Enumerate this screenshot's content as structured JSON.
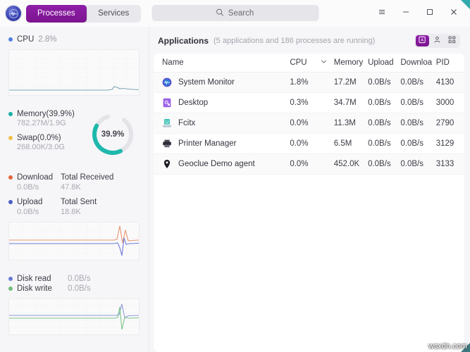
{
  "titlebar": {
    "logo_icon": "system-monitor-logo-icon",
    "tabs": [
      {
        "label": "Processes",
        "active": true
      },
      {
        "label": "Services",
        "active": false
      }
    ],
    "search": {
      "placeholder": "Search",
      "value": "",
      "icon": "search-icon"
    },
    "controls": [
      {
        "name": "menu-button",
        "icon": "hamburger-icon"
      },
      {
        "name": "minimize-button",
        "icon": "minimize-icon"
      },
      {
        "name": "maximize-button",
        "icon": "maximize-icon"
      },
      {
        "name": "close-button",
        "icon": "close-icon"
      }
    ]
  },
  "sidebar": {
    "cpu": {
      "label": "CPU",
      "value": "2.8%",
      "color": "#4f7fe0"
    },
    "memory": {
      "label": "Memory(39.9%)",
      "detail": "782.27M/1.9G",
      "color": "#18b0a6",
      "swap_label": "Swap(0.0%)",
      "swap_detail": "268.00K/3.0G",
      "swap_color": "#f0c04a",
      "donut_percent": "39.9%",
      "donut_value": 39.9
    },
    "network": {
      "download_label": "Download",
      "download_value": "0.0B/s",
      "download_color": "#e2663b",
      "upload_label": "Upload",
      "upload_value": "0.0B/s",
      "upload_color": "#4a5fc1",
      "total_received_label": "Total Received",
      "total_received_value": "47.8K",
      "total_sent_label": "Total Sent",
      "total_sent_value": "18.8K"
    },
    "disk": {
      "read_label": "Disk read",
      "read_value": "0.0B/s",
      "read_color": "#6b79d6",
      "write_label": "Disk write",
      "write_value": "0.0B/s",
      "write_color": "#6fbd7a"
    }
  },
  "main": {
    "section_title": "Applications",
    "section_subtitle": "(5 applications and 186 processes are running)",
    "view_modes": [
      {
        "name": "applications-view",
        "icon": "applications-icon",
        "active": true
      },
      {
        "name": "my-processes-view",
        "icon": "user-icon",
        "active": false
      },
      {
        "name": "all-processes-view",
        "icon": "grid-icon",
        "active": false
      }
    ],
    "columns": [
      {
        "key": "name",
        "label": "Name"
      },
      {
        "key": "cpu",
        "label": "CPU",
        "sorted": true,
        "sort_icon": "chevron-down-icon"
      },
      {
        "key": "memory",
        "label": "Memory"
      },
      {
        "key": "upload",
        "label": "Upload"
      },
      {
        "key": "download",
        "label": "Downloa"
      },
      {
        "key": "pid",
        "label": "PID"
      }
    ],
    "rows": [
      {
        "icon": "system-monitor-app-icon",
        "name": "System Monitor",
        "cpu": "1.8%",
        "memory": "17.2M",
        "upload": "0.0B/s",
        "download": "0.0B/s",
        "pid": "4130"
      },
      {
        "icon": "desktop-app-icon",
        "name": "Desktop",
        "cpu": "0.3%",
        "memory": "34.7M",
        "upload": "0.0B/s",
        "download": "0.0B/s",
        "pid": "3000"
      },
      {
        "icon": "fcitx-app-icon",
        "name": "Fcitx",
        "cpu": "0.0%",
        "memory": "11.3M",
        "upload": "0.0B/s",
        "download": "0.0B/s",
        "pid": "2790"
      },
      {
        "icon": "printer-app-icon",
        "name": "Printer Manager",
        "cpu": "0.0%",
        "memory": "6.5M",
        "upload": "0.0B/s",
        "download": "0.0B/s",
        "pid": "3129"
      },
      {
        "icon": "location-pin-icon",
        "name": "Geoclue Demo agent",
        "cpu": "0.0%",
        "memory": "452.0K",
        "upload": "0.0B/s",
        "download": "0.0B/s",
        "pid": "3133"
      }
    ]
  },
  "watermark": {
    "text": "wsxdn.com"
  }
}
